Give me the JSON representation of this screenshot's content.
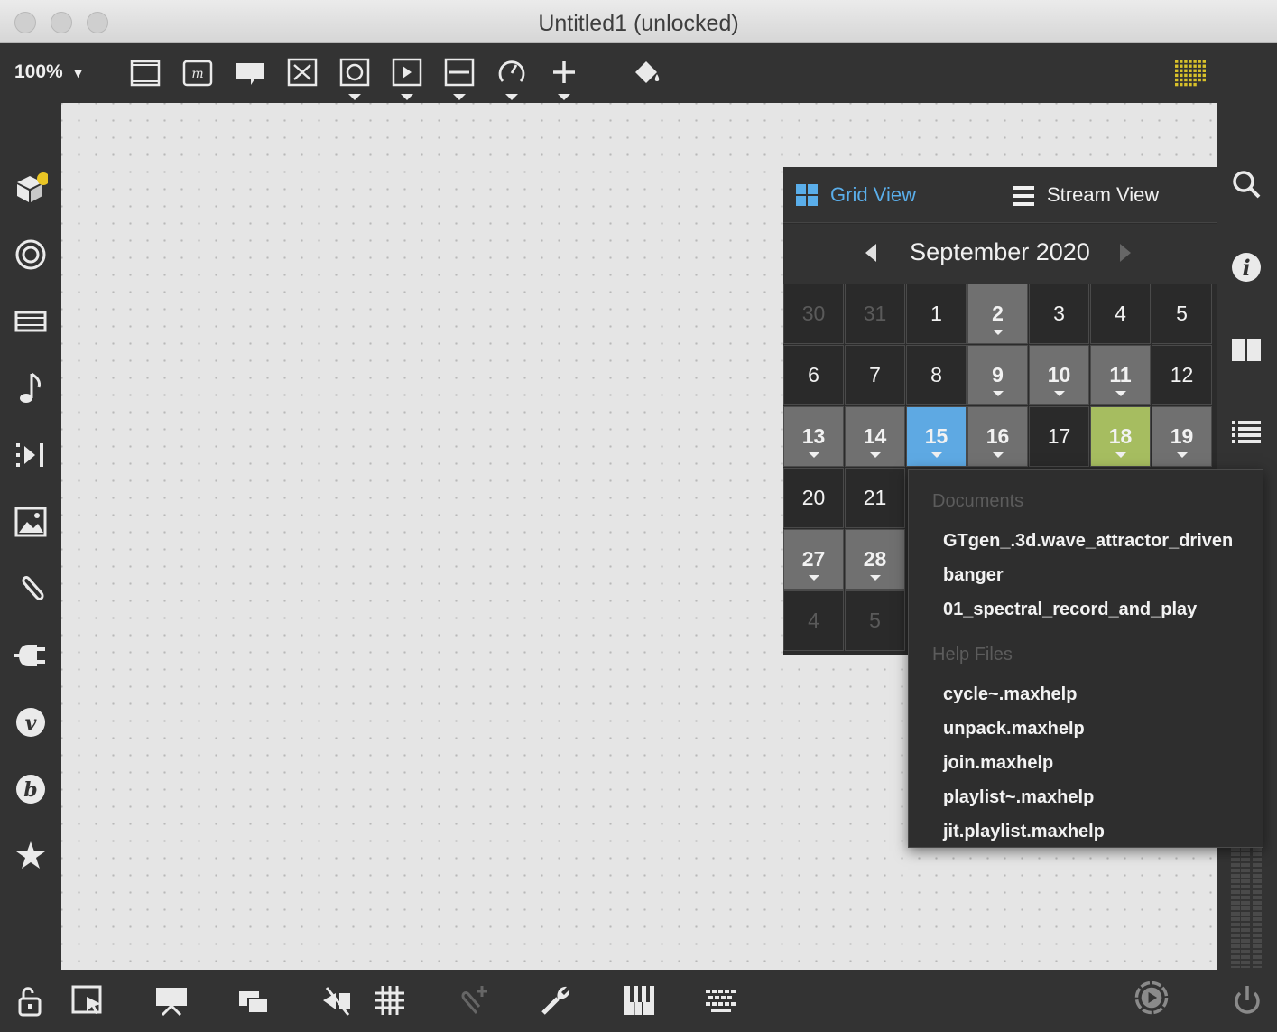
{
  "window": {
    "title": "Untitled1 (unlocked)"
  },
  "toolbar": {
    "zoom": "100%",
    "icons": [
      "object-box-icon",
      "message-box-icon",
      "comment-icon",
      "toggle-icon",
      "button-icon",
      "play-icon",
      "slider-icon",
      "dial-icon",
      "plus-icon",
      "paint-bucket-icon",
      "grid-apps-icon"
    ]
  },
  "left_sidebar": {
    "icons": [
      "package-icon",
      "target-icon",
      "media-icon",
      "music-note-icon",
      "playlist-icon",
      "image-icon",
      "attachment-icon",
      "plug-icon",
      "vst-icon",
      "bpatcher-icon",
      "star-icon"
    ]
  },
  "right_sidebar": {
    "icons": [
      "search-icon",
      "info-icon",
      "reference-icon",
      "list-icon"
    ]
  },
  "calendar": {
    "tabs": {
      "grid": "Grid View",
      "stream": "Stream View"
    },
    "month": "September 2020",
    "weeks": [
      [
        {
          "d": "30",
          "s": "out"
        },
        {
          "d": "31",
          "s": "out"
        },
        {
          "d": "1",
          "s": "plain"
        },
        {
          "d": "2",
          "s": "file"
        },
        {
          "d": "3",
          "s": "plain"
        },
        {
          "d": "4",
          "s": "plain"
        },
        {
          "d": "5",
          "s": "plain"
        }
      ],
      [
        {
          "d": "6",
          "s": "plain"
        },
        {
          "d": "7",
          "s": "plain"
        },
        {
          "d": "8",
          "s": "plain"
        },
        {
          "d": "9",
          "s": "file"
        },
        {
          "d": "10",
          "s": "file"
        },
        {
          "d": "11",
          "s": "file"
        },
        {
          "d": "12",
          "s": "plain"
        }
      ],
      [
        {
          "d": "13",
          "s": "file"
        },
        {
          "d": "14",
          "s": "file"
        },
        {
          "d": "15",
          "s": "today"
        },
        {
          "d": "16",
          "s": "file"
        },
        {
          "d": "17",
          "s": "plain"
        },
        {
          "d": "18",
          "s": "sel"
        },
        {
          "d": "19",
          "s": "file"
        }
      ],
      [
        {
          "d": "20",
          "s": "plain"
        },
        {
          "d": "21",
          "s": "plain"
        }
      ],
      [
        {
          "d": "27",
          "s": "file"
        },
        {
          "d": "28",
          "s": "file"
        }
      ],
      [
        {
          "d": "4",
          "s": "out"
        },
        {
          "d": "5",
          "s": "out"
        }
      ]
    ]
  },
  "popup": {
    "documents_header": "Documents",
    "documents": [
      "GTgen_.3d.wave_attractor_driven",
      "banger",
      "01_spectral_record_and_play"
    ],
    "help_header": "Help Files",
    "help_files": [
      "cycle~.maxhelp",
      "unpack.maxhelp",
      "join.maxhelp",
      "playlist~.maxhelp",
      "jit.playlist.maxhelp"
    ]
  },
  "bottombar": {
    "icons": [
      "lock-icon",
      "presentation-pointer-icon",
      "presentation-icon",
      "windows-icon",
      "hide-icon",
      "grid-icon",
      "attach-add-icon",
      "wrench-icon",
      "piano-icon",
      "keyboard-icon",
      "transport-play-icon",
      "power-icon"
    ]
  }
}
